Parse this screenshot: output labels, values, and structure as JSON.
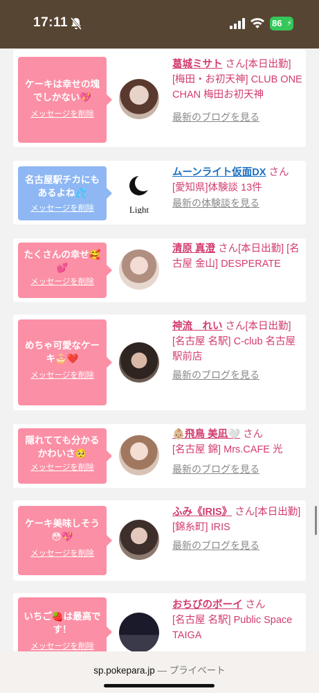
{
  "status_bar": {
    "time": "17:11",
    "battery": "86",
    "background": "#574533"
  },
  "colors": {
    "pink_bubble": "#fb8fa5",
    "blue_bubble": "#8eb7f3",
    "name_pink": "#d23b6d",
    "name_blue": "#1b6fc2"
  },
  "messages": [
    {
      "bubble": "ケーキは幸せの塊でしかない💖",
      "delete": "メッセージを削除",
      "name": "葛城ミサト",
      "san": "さん",
      "detail": "[本日出勤] [梅田・お初天神] CLUB ONE CHAN 梅田お初天神",
      "link": "最新のブログを見る"
    },
    {
      "bubble": "名古屋駅チカにもあるよね💦",
      "delete": "メッセージを削除",
      "name": "ムーンライト仮面DX",
      "san": "さん",
      "detail": "[愛知県]体験談 13件",
      "link": "最新の体験談を見る",
      "logo_text": "Light"
    },
    {
      "bubble": "たくさんの幸せ🥰💕",
      "delete": "メッセージを削除",
      "name": "清原 真澄",
      "san": "さん",
      "detail": "[本日出勤] [名古屋 金山] DESPERATE",
      "link": ""
    },
    {
      "bubble": "めちゃ可愛なケーキ🎂❤️",
      "delete": "メッセージを削除",
      "name": "神流　れい",
      "san": "さん",
      "detail": "[本日出勤] [名古屋 名駅] C-club 名古屋駅前店",
      "link": "最新のブログを見る"
    },
    {
      "bubble": "隠れてても分かるかわいさ🥺",
      "delete": "メッセージを削除",
      "name": "👶🏼飛鳥 美凪🤍",
      "san": "さん",
      "detail": "[名古屋 錦] Mrs.CAFE 光",
      "link": "最新のブログを見る"
    },
    {
      "bubble": "ケーキ美味しそう😳💖",
      "delete": "メッセージを削除",
      "name": "ふみ《IRIS》",
      "san": "さん",
      "detail": "[本日出勤] [錦糸町] IRIS",
      "link": "最新のブログを見る"
    },
    {
      "bubble": "いちご🍓は最高です！",
      "delete": "メッセージを削除",
      "name": "おちびのボーイ",
      "san": "さん",
      "detail": "[名古屋 名駅] Public Space TAIGA",
      "link": ""
    }
  ],
  "bottom": {
    "url": "sp.pokepara.jp",
    "label": "— プライベート"
  }
}
